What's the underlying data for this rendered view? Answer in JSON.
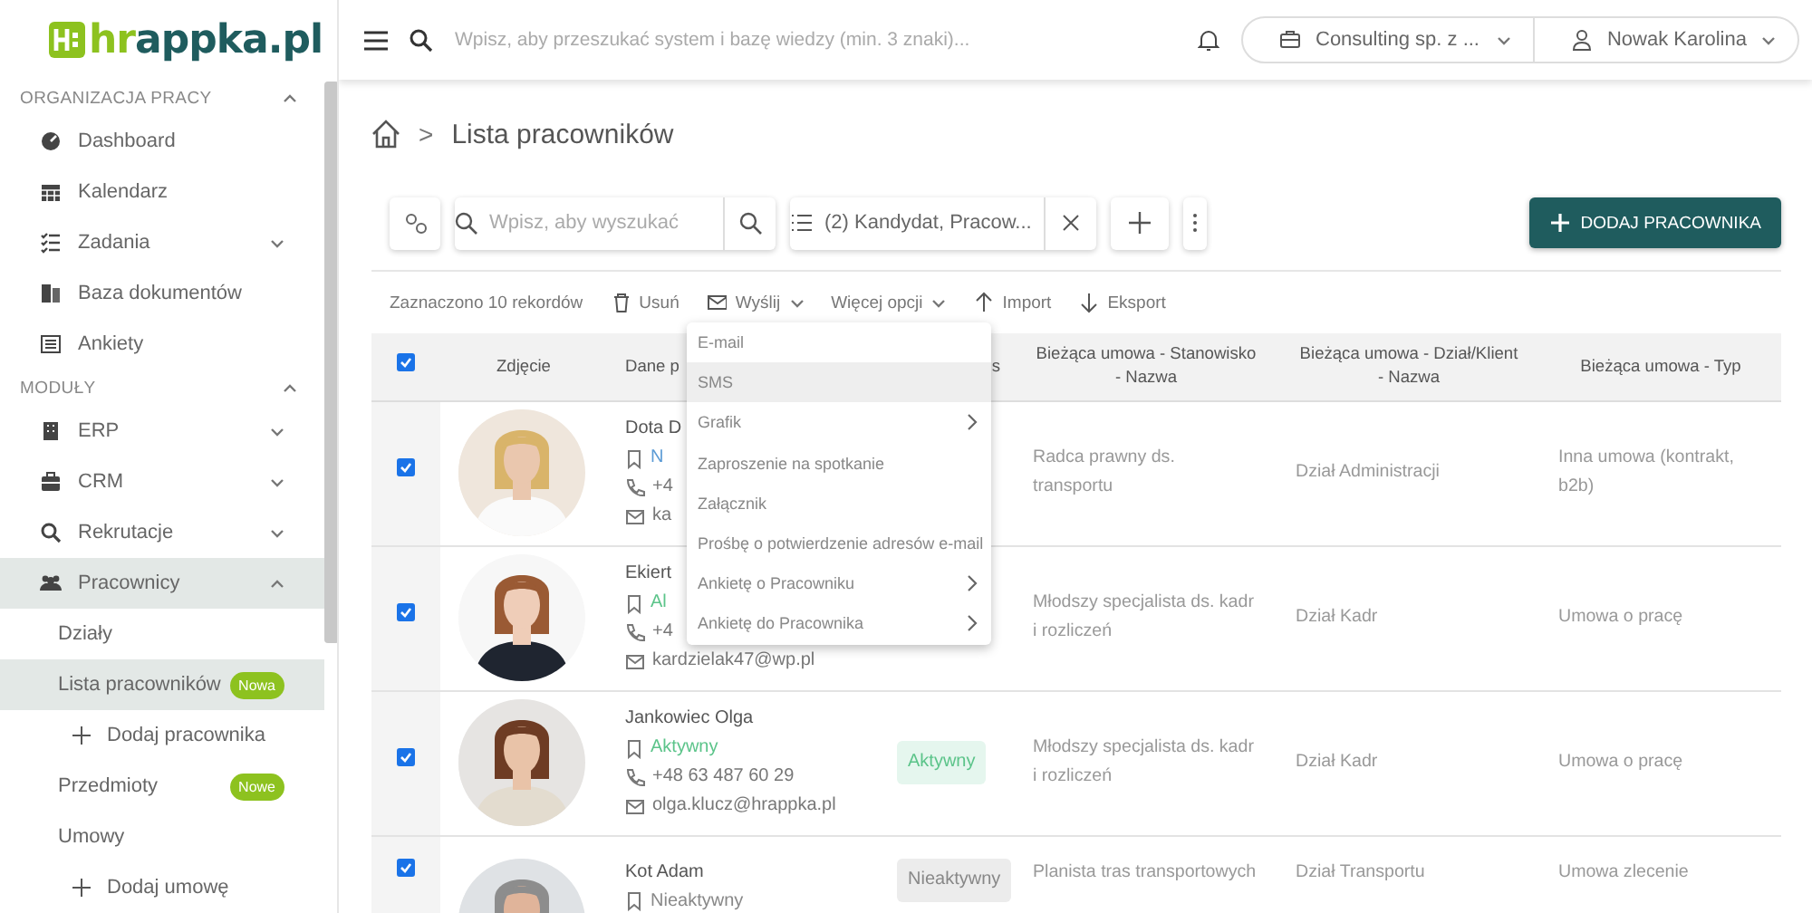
{
  "sidebar": {
    "logo": {
      "accent": "hr",
      "rest": "appka.pl"
    },
    "sections": [
      {
        "title": "ORGANIZACJA PRACY",
        "expanded": true,
        "items": [
          {
            "label": "Dashboard",
            "selected": false
          },
          {
            "label": "Kalendarz",
            "selected": false
          },
          {
            "label": "Zadania",
            "selected": false,
            "expanded": false
          },
          {
            "label": "Baza dokumentów",
            "selected": false
          },
          {
            "label": "Ankiety",
            "selected": false
          }
        ]
      },
      {
        "title": "MODUŁY",
        "expanded": true,
        "items": [
          {
            "label": "ERP",
            "selected": false,
            "expanded": false
          },
          {
            "label": "CRM",
            "selected": false,
            "expanded": false
          },
          {
            "label": "Rekrutacje",
            "selected": false,
            "expanded": false
          },
          {
            "label": "Pracownicy",
            "selected": true,
            "expanded": true,
            "children": [
              {
                "label": "Działy",
                "selected": false
              },
              {
                "label": "Lista pracowników",
                "selected": true,
                "badge": "Nowa",
                "children": [
                  {
                    "label": "Dodaj pracownika",
                    "selected": false
                  }
                ]
              },
              {
                "label": "Przedmioty",
                "selected": false,
                "badge": "Nowe"
              },
              {
                "label": "Umowy",
                "selected": false,
                "children": [
                  {
                    "label": "Dodaj umowę",
                    "selected": false
                  }
                ]
              }
            ]
          }
        ]
      }
    ]
  },
  "topbar": {
    "search_placeholder": "Wpisz, aby przeszukać system i bazę wiedzy (min. 3 znaki)...",
    "company": "Consulting sp. z ...",
    "user": "Nowak Karolina"
  },
  "breadcrumb": {
    "separator": ">",
    "title": "Lista pracowników"
  },
  "toolbar": {
    "search_placeholder": "Wpisz, aby wyszukać",
    "filter": "(2) Kandydat, Pracow...",
    "add_button": "DODAJ PRACOWNIKA"
  },
  "actions": {
    "selection": "Zaznaczono 10 rekordów",
    "buttons": [
      {
        "label": "Usuń",
        "kind": "delete",
        "dropdown": false
      },
      {
        "label": "Wyślij",
        "kind": "send",
        "dropdown": true
      },
      {
        "label": "Więcej opcji",
        "kind": "more",
        "dropdown": true
      },
      {
        "label": "Import",
        "kind": "import",
        "dropdown": false
      },
      {
        "label": "Eksport",
        "kind": "export",
        "dropdown": false
      }
    ]
  },
  "send_menu": {
    "items": [
      {
        "label": "E-mail",
        "selected": false,
        "submenu": false
      },
      {
        "label": "SMS",
        "selected": true,
        "submenu": false
      },
      {
        "label": "Grafik",
        "selected": false,
        "submenu": true
      },
      {
        "label": "Zaproszenie na spotkanie",
        "selected": false,
        "submenu": false
      },
      {
        "label": "Załącznik",
        "selected": false,
        "submenu": false
      },
      {
        "label": "Prośbę o potwierdzenie adresów e-mail",
        "selected": false,
        "submenu": false
      },
      {
        "label": "Ankietę o Pracowniku",
        "selected": false,
        "submenu": true
      },
      {
        "label": "Ankietę do Pracownika",
        "selected": false,
        "submenu": true
      }
    ]
  },
  "table": {
    "select_all": true,
    "columns": [
      "Zdjęcie",
      "Dane p",
      "s",
      "Bieżąca umowa - Stanowisko - Nazwa",
      "Bieżąca umowa - Dział/Klient - Nazwa",
      "Bieżąca umowa - Typ"
    ],
    "rows": [
      {
        "selected": true,
        "name": "Dota D",
        "status": {
          "text": "N",
          "color": "#5b9bd5"
        },
        "phone": "+4",
        "email": "ka",
        "position": "Radca prawny ds. transportu",
        "department": "Dział Administracji",
        "type": "Inna umowa (kontrakt, b2b)"
      },
      {
        "selected": true,
        "name": "Ekiert",
        "status": {
          "text": "Al",
          "color": "#5cc48a"
        },
        "phone": "+4",
        "email": "kardzielak47@wp.pl",
        "position": "Młodszy specjalista ds. kadr i rozliczeń",
        "department": "Dział Kadr",
        "type": "Umowa o pracę"
      },
      {
        "selected": true,
        "name": "Jankowiec Olga",
        "status": {
          "text": "Aktywny",
          "color": "#5cc48a"
        },
        "phone": "+48 63 487 60 29",
        "email": "olga.klucz@hrappka.pl",
        "badge": {
          "text": "Aktywny",
          "kind": "active"
        },
        "position": "Młodszy specjalista ds. kadr i rozliczeń",
        "department": "Dział Kadr",
        "type": "Umowa o pracę"
      },
      {
        "selected": true,
        "name": "Kot Adam",
        "status": {
          "text": "Nieaktywny",
          "color": "#888888"
        },
        "badge": {
          "text": "Nieaktywny",
          "kind": "inactive"
        },
        "position": "Planista tras transportowych",
        "department": "Dział Transportu",
        "type": "Umowa zlecenie"
      }
    ]
  }
}
